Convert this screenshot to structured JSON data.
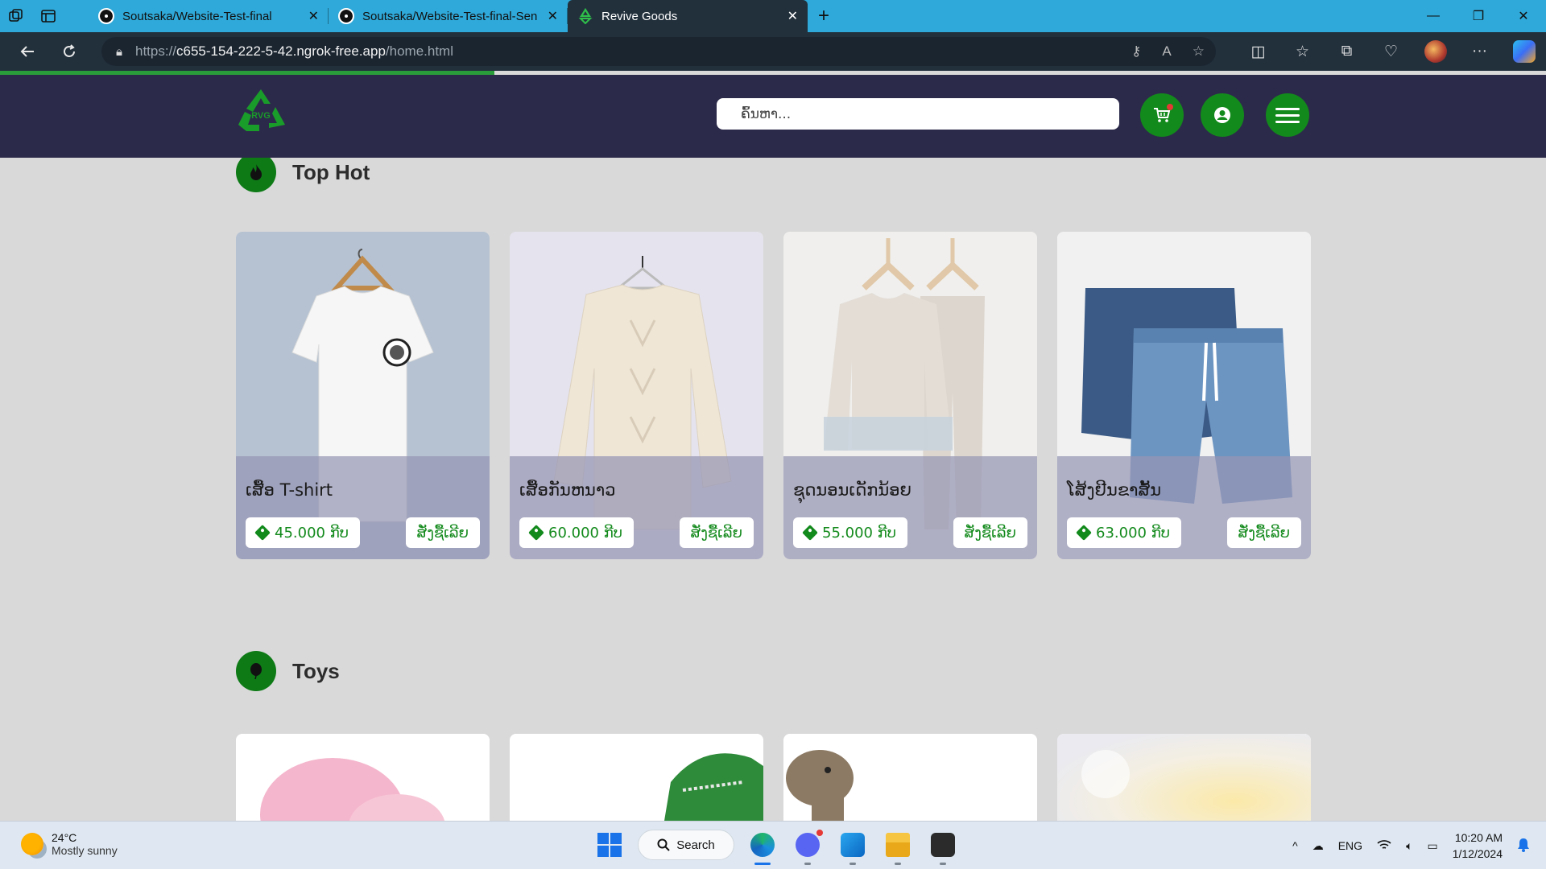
{
  "browser": {
    "tabs": [
      {
        "title": "Soutsaka/Website-Test-final",
        "active": false
      },
      {
        "title": "Soutsaka/Website-Test-final-Sen",
        "active": false
      },
      {
        "title": "Revive Goods",
        "active": true
      }
    ],
    "url": {
      "scheme": "https://",
      "host": "c655-154-222-5-42.ngrok-free.app",
      "path": "/home.html"
    },
    "loading_progress": 0.32
  },
  "site": {
    "logo_text": "RVG",
    "search_placeholder": "ຄົ້ນຫາ...",
    "brand_color": "#138a1c",
    "header_color": "#2c2a4a"
  },
  "sections": {
    "top_hot": {
      "title": "Top Hot",
      "icon": "fire-icon",
      "products": [
        {
          "name": "ເສື້ອ T-shirt",
          "price": "45.000 ກີບ",
          "buy": "ສັ່ງຊື້ເລີຍ"
        },
        {
          "name": "ເສື້ອກັນຫນາວ",
          "price": "60.000 ກີບ",
          "buy": "ສັ່ງຊື້ເລີຍ"
        },
        {
          "name": "ຊຸດນອນເດັກນ້ອຍ",
          "price": "55.000 ກີບ",
          "buy": "ສັ່ງຊື້ເລີຍ"
        },
        {
          "name": "ໂສ້ງຢີນຂາສັ້ນ",
          "price": "63.000 ກີບ",
          "buy": "ສັ່ງຊື້ເລີຍ"
        }
      ]
    },
    "toys": {
      "title": "Toys",
      "icon": "balloon-icon"
    }
  },
  "taskbar": {
    "weather_temp": "24°C",
    "weather_desc": "Mostly sunny",
    "search_label": "Search",
    "lang": "ENG",
    "time": "10:20 AM",
    "date": "1/12/2024"
  }
}
